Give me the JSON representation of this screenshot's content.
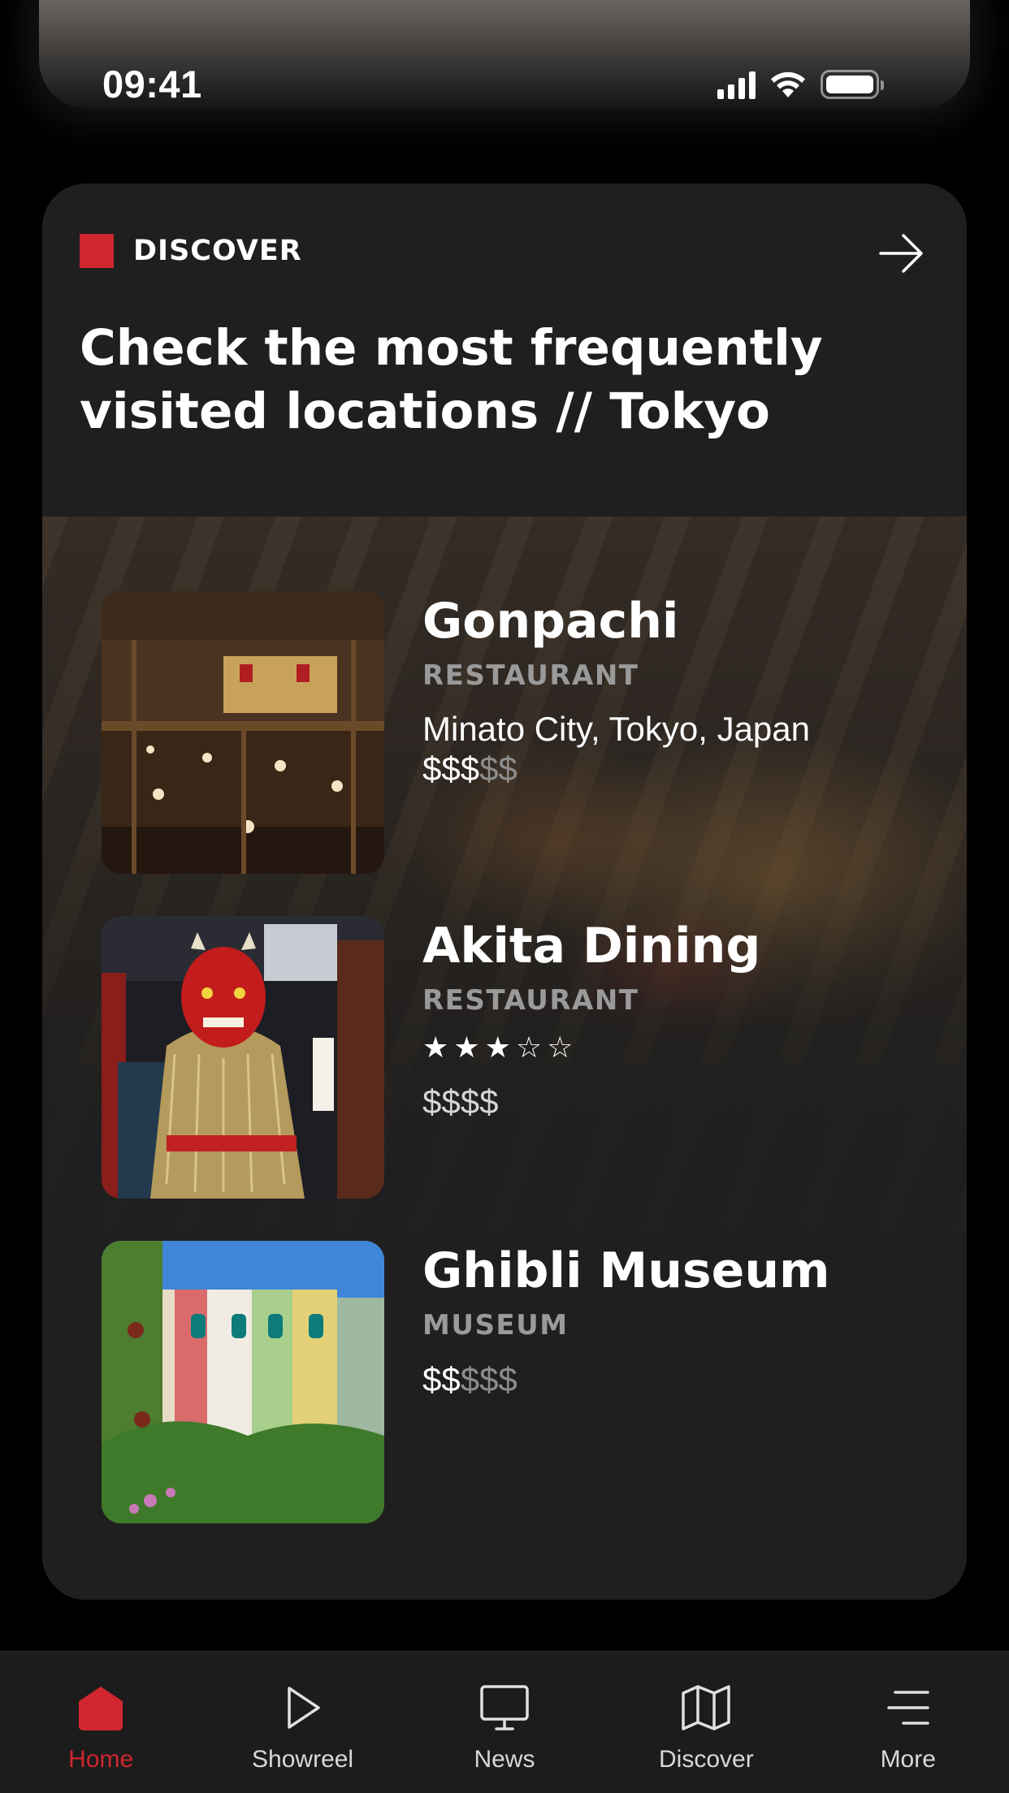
{
  "status_bar": {
    "time": "09:41",
    "signal_icon": "cellular-signal-icon",
    "wifi_icon": "wifi-icon",
    "battery_icon": "battery-icon"
  },
  "discover_card": {
    "section_label": "DISCOVER",
    "accent_color": "#d0262f",
    "title": "Check the most frequently visited locations // Tokyo",
    "arrow_icon": "arrow-right-icon",
    "places": [
      {
        "name": "Gonpachi",
        "type": "RESTAURANT",
        "address": "Minato City, Tokyo, Japan",
        "price_active": "$$$",
        "price_inactive": "$$",
        "price_level": 3,
        "price_max": 5
      },
      {
        "name": "Akita Dining",
        "type": "RESTAURANT",
        "rating": 3,
        "rating_max": 5,
        "price_active": "$$$$",
        "price_inactive": "",
        "price_level": 4,
        "price_max": 4
      },
      {
        "name": "Ghibli Museum",
        "type": "MUSEUM",
        "price_active": "$$",
        "price_inactive": "$$$",
        "price_level": 2,
        "price_max": 5
      }
    ]
  },
  "tab_bar": {
    "active_color": "#d0262f",
    "tabs": [
      {
        "label": "Home",
        "icon": "home-icon",
        "active": true
      },
      {
        "label": "Showreel",
        "icon": "play-icon",
        "active": false
      },
      {
        "label": "News",
        "icon": "monitor-icon",
        "active": false
      },
      {
        "label": "Discover",
        "icon": "map-icon",
        "active": false
      },
      {
        "label": "More",
        "icon": "menu-icon",
        "active": false
      }
    ]
  }
}
